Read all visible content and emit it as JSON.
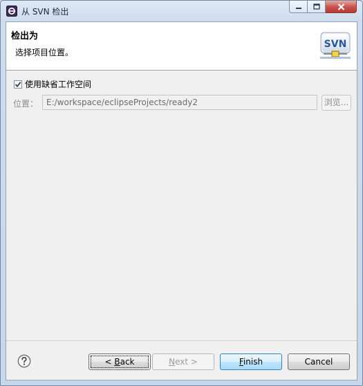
{
  "window": {
    "title": "从 SVN 检出",
    "buttons": {
      "minimize": "minimize",
      "maximize": "maximize",
      "close": "close"
    }
  },
  "banner": {
    "title": "检出为",
    "description": "选择项目位置。",
    "logo_text": "SVN"
  },
  "form": {
    "use_default_workspace": {
      "label": "使用缺省工作空间",
      "checked": true
    },
    "location": {
      "label": "位置：",
      "value": "E:/workspace/eclipseProjects/ready2",
      "enabled": false
    },
    "browse_button": "浏览..."
  },
  "footer": {
    "help_icon": "question-circle-icon",
    "back": {
      "prefix": "< ",
      "mnemonic": "B",
      "rest": "ack"
    },
    "next": {
      "mnemonic": "N",
      "rest": "ext >",
      "enabled": false
    },
    "finish": {
      "mnemonic": "F",
      "rest": "inish"
    },
    "cancel": "Cancel"
  },
  "colors": {
    "accent_finish_border": "#3c7fb1",
    "close_button": "#c75050"
  }
}
